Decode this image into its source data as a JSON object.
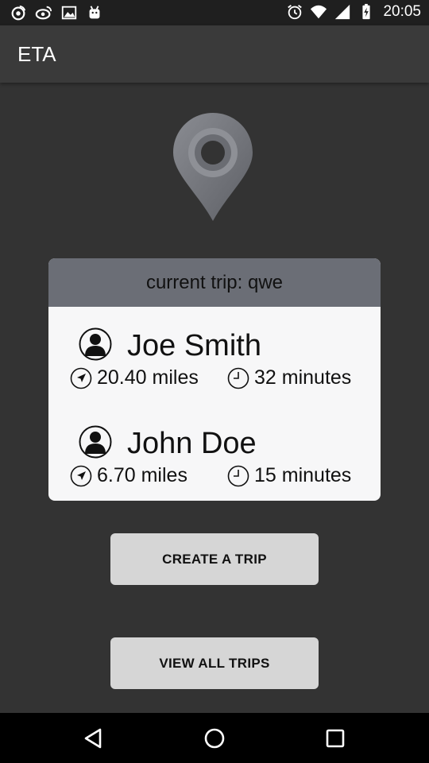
{
  "status_bar": {
    "time": "20:05",
    "left_icons": [
      "weibo-icon",
      "weibo-icon",
      "image-icon",
      "android-icon"
    ],
    "right_icons": [
      "alarm-icon",
      "wifi-icon",
      "signal-icon",
      "battery-charging-icon"
    ]
  },
  "app_bar": {
    "title": "ETA"
  },
  "trip": {
    "header": "current trip: qwe",
    "riders": [
      {
        "name": "Joe Smith",
        "distance": "20.40 miles",
        "time": "32 minutes"
      },
      {
        "name": "John Doe",
        "distance": "6.70 miles",
        "time": "15 minutes"
      }
    ]
  },
  "buttons": {
    "create": "CREATE A TRIP",
    "view": "VIEW ALL TRIPS"
  },
  "colors": {
    "background": "#333333",
    "card_header": "#6b6e76",
    "card_body": "#f7f7f8",
    "button": "#d6d6d6"
  }
}
